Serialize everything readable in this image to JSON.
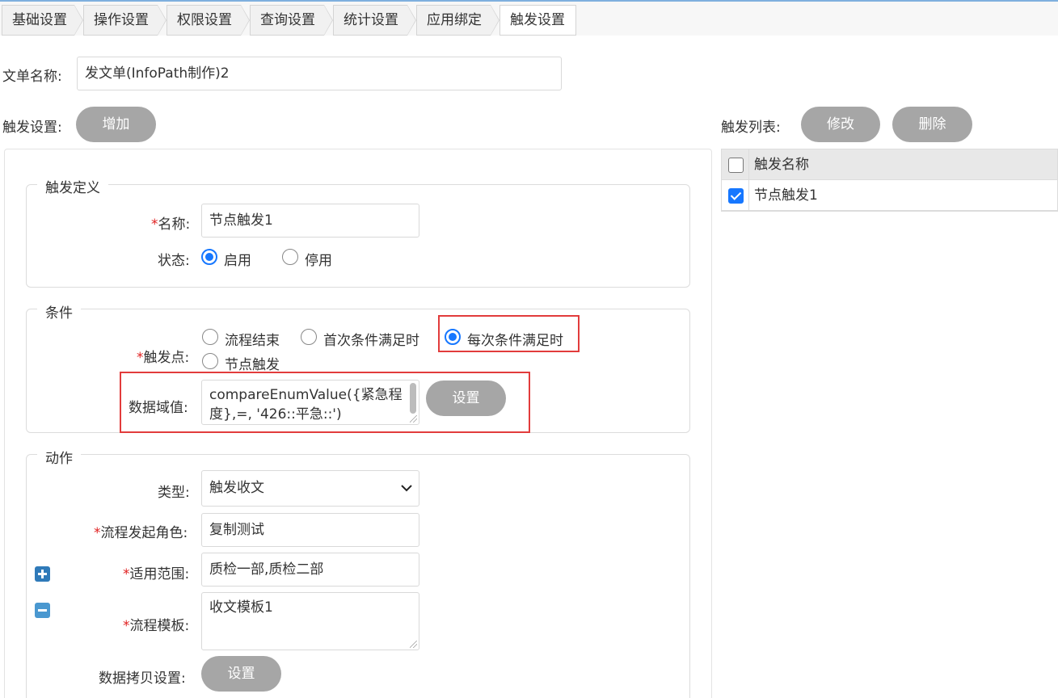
{
  "tabs": [
    {
      "label": "基础设置"
    },
    {
      "label": "操作设置"
    },
    {
      "label": "权限设置"
    },
    {
      "label": "查询设置"
    },
    {
      "label": "统计设置"
    },
    {
      "label": "应用绑定"
    },
    {
      "label": "触发设置"
    }
  ],
  "form_name": {
    "label": "文单名称:",
    "value": "发文单(InfoPath制作)2"
  },
  "trigger_settings": {
    "label": "触发设置:",
    "add_button": "增加"
  },
  "trigger_list": {
    "label": "触发列表:",
    "edit_button": "修改",
    "delete_button": "删除",
    "column_header": "触发名称",
    "rows": [
      {
        "name": "节点触发1",
        "checked": true
      }
    ]
  },
  "definition": {
    "legend": "触发定义",
    "name_label": "名称:",
    "name_value": "节点触发1",
    "status_label": "状态:",
    "status_options": [
      "启用",
      "停用"
    ],
    "status_selected": "启用"
  },
  "condition": {
    "legend": "条件",
    "trigger_point_label": "触发点:",
    "trigger_points": [
      "流程结束",
      "首次条件满足时",
      "每次条件满足时",
      "节点触发"
    ],
    "trigger_point_selected": "每次条件满足时",
    "data_value_label": "数据域值:",
    "data_value": "compareEnumValue({紧急程度},=, '426::平急::')",
    "set_button": "设置"
  },
  "action": {
    "legend": "动作",
    "type_label": "类型:",
    "type_value": "触发收文",
    "initiator_label": "流程发起角色:",
    "initiator_value": "复制测试",
    "scope_label": "适用范围:",
    "scope_value": "质检一部,质检二部",
    "template_label": "流程模板:",
    "template_value": "收文模板1",
    "copy_label": "数据拷贝设置:",
    "copy_button": "设置"
  },
  "colors": {
    "accent": "#1677ff",
    "highlight_border": "#e23c3c",
    "button_gray": "#a6a6a6"
  }
}
